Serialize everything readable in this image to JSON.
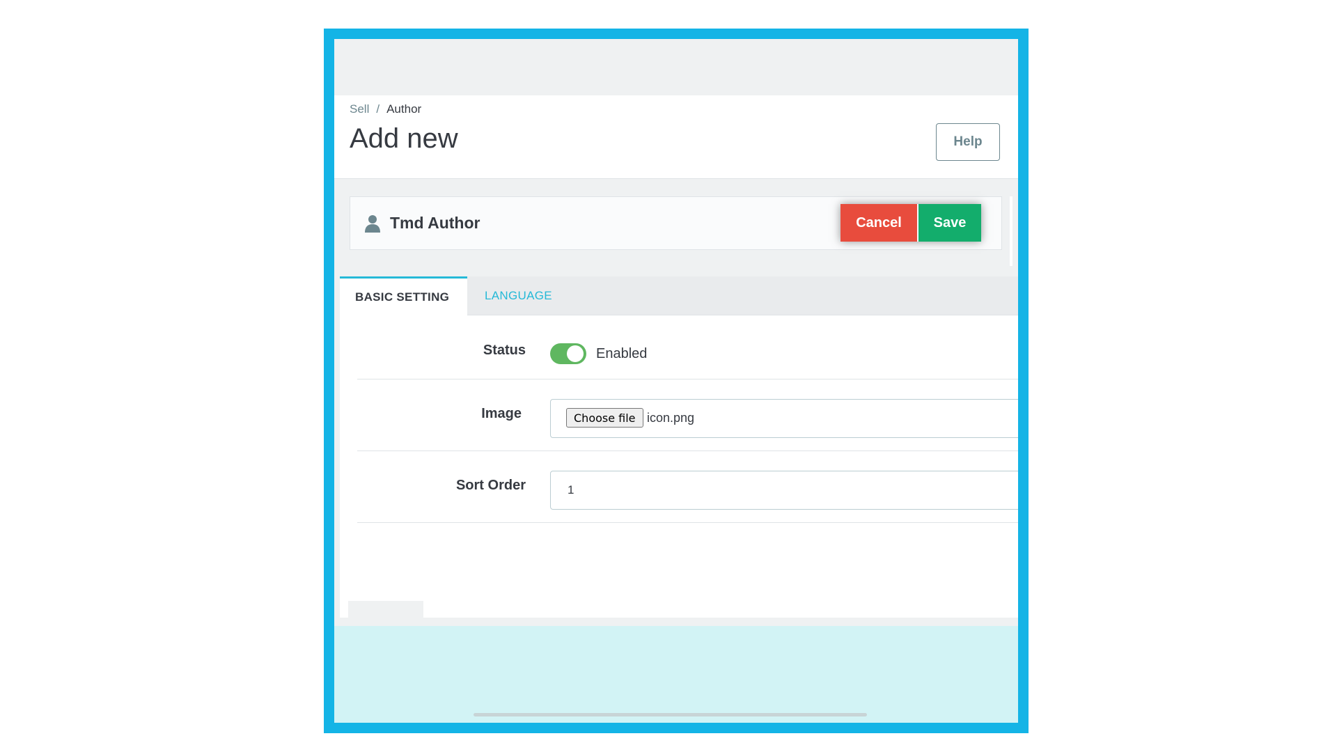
{
  "breadcrumb": {
    "parent": "Sell",
    "separator": "/",
    "current": "Author"
  },
  "header": {
    "title": "Add new",
    "help_label": "Help"
  },
  "panel": {
    "title": "Tmd Author",
    "icon": "user-icon",
    "cancel_label": "Cancel",
    "save_label": "Save"
  },
  "tabs": [
    {
      "label": "BASIC SETTING",
      "active": true
    },
    {
      "label": "LANGUAGE",
      "active": false
    }
  ],
  "form": {
    "status": {
      "label": "Status",
      "value_text": "Enabled",
      "enabled": true
    },
    "image": {
      "label": "Image",
      "button_label": "Choose file",
      "file_name": "icon.png"
    },
    "sort_order": {
      "label": "Sort Order",
      "value": "1"
    }
  },
  "colors": {
    "frame": "#14b4e6",
    "cancel": "#e84c3d",
    "save": "#13ad6c",
    "tab_accent": "#25b9d7",
    "toggle_on": "#5fb760"
  }
}
